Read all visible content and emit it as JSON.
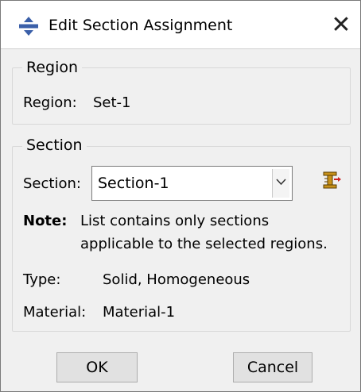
{
  "window": {
    "title": "Edit Section Assignment",
    "close_glyph": "✕"
  },
  "region_group": {
    "legend": "Region",
    "label": "Region:",
    "value": "Set-1"
  },
  "section_group": {
    "legend": "Section",
    "section_label": "Section:",
    "section_value": "Section-1",
    "note_label": "Note:",
    "note_line1": "List contains only sections",
    "note_line2": "applicable to the selected regions.",
    "type_label": "Type:",
    "type_value": "Solid, Homogeneous",
    "material_label": "Material:",
    "material_value": "Material-1"
  },
  "buttons": {
    "ok": "OK",
    "cancel": "Cancel"
  },
  "icons": {
    "app_icon": "abaqus-crosshair-icon",
    "create_section_icon": "section-manager-icon",
    "dropdown_icon": "chevron-down-icon"
  },
  "colors": {
    "app_icon": "#3a5fa8",
    "section_icon": "#c8921a"
  }
}
